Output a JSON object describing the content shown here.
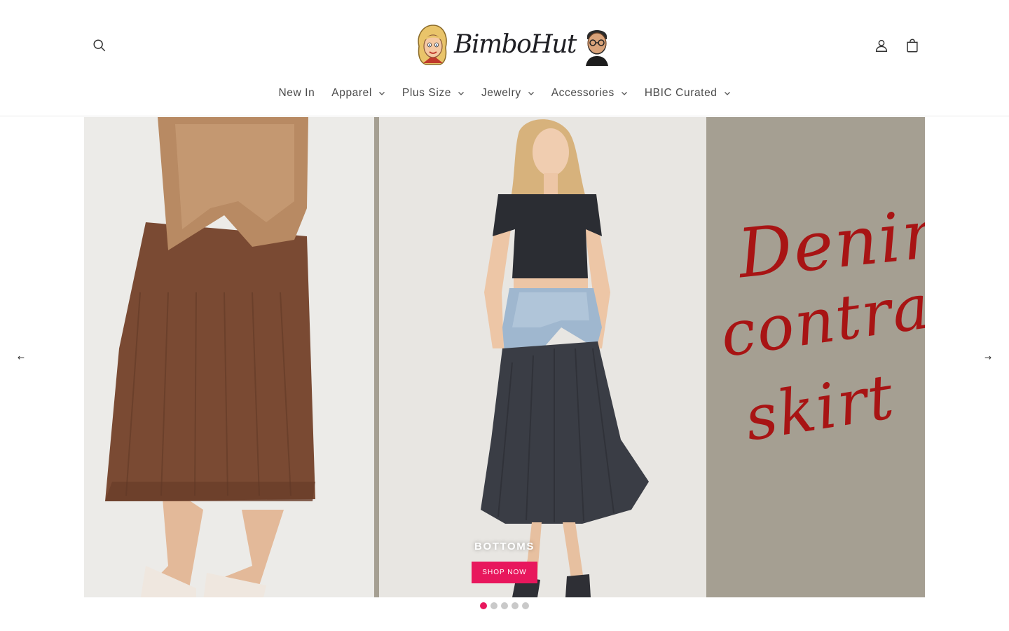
{
  "brand": {
    "name": "BimboHut",
    "accent": "#e8175d"
  },
  "header": {
    "icons": {
      "search": "search-icon",
      "account": "account-icon",
      "cart": "cart-icon"
    }
  },
  "nav": {
    "items": [
      {
        "label": "New In",
        "has_dropdown": false
      },
      {
        "label": "Apparel",
        "has_dropdown": true
      },
      {
        "label": "Plus Size",
        "has_dropdown": true
      },
      {
        "label": "Jewelry",
        "has_dropdown": true
      },
      {
        "label": "Accessories",
        "has_dropdown": true
      },
      {
        "label": "HBIC Curated",
        "has_dropdown": true
      }
    ]
  },
  "slideshow": {
    "promo_lines": [
      "Denim",
      "contrast",
      "skirt"
    ],
    "heading": "BOTTOMS",
    "button_label": "SHOP NOW",
    "prev_label": "←",
    "next_label": "→",
    "slide_count": 5,
    "active_slide": 1
  },
  "colors": {
    "promo_text": "#a81414",
    "promo_panel": "#a59f92",
    "dot_inactive": "#c9c9c9"
  }
}
